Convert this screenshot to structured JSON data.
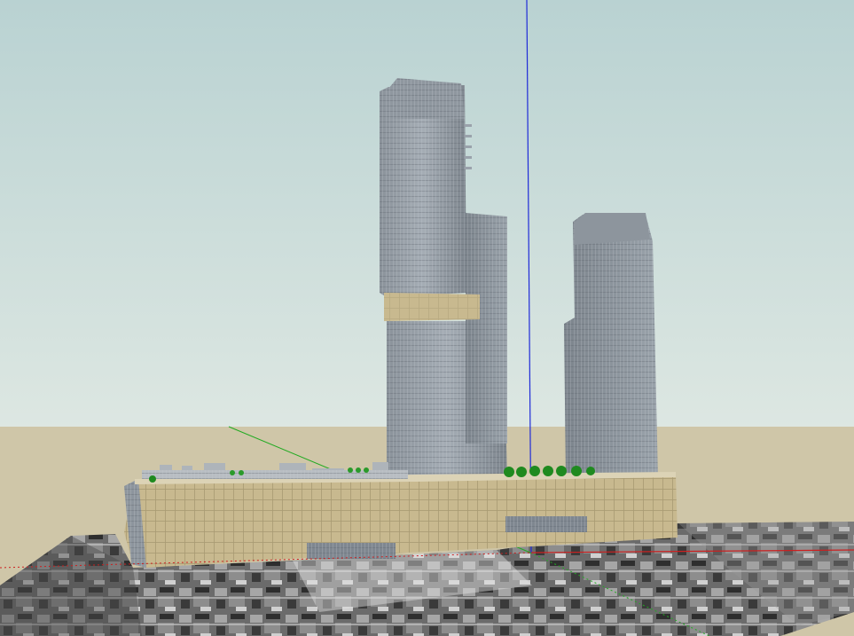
{
  "viewport": {
    "sky_top_color": "#b9d2d2",
    "sky_bottom_color": "#dde7e2",
    "ground_color": "#cfc6a8",
    "axis_colors": {
      "blue": "#1f2bd8",
      "green": "#22aa22",
      "red": "#cc2020"
    }
  },
  "model": {
    "podium_color": "#c8b98f",
    "podium_band_color": "#bfae81",
    "tower_glass_color": "#7f8790",
    "tower_glass_light": "#9aa2ab",
    "tower_glass_dark": "#5d646c",
    "tree_color": "#1f8a1f",
    "icons": [
      "tall-tower-icon",
      "short-tower-icon",
      "podium-icon",
      "tree-icon",
      "aerial-photo-icon"
    ]
  }
}
